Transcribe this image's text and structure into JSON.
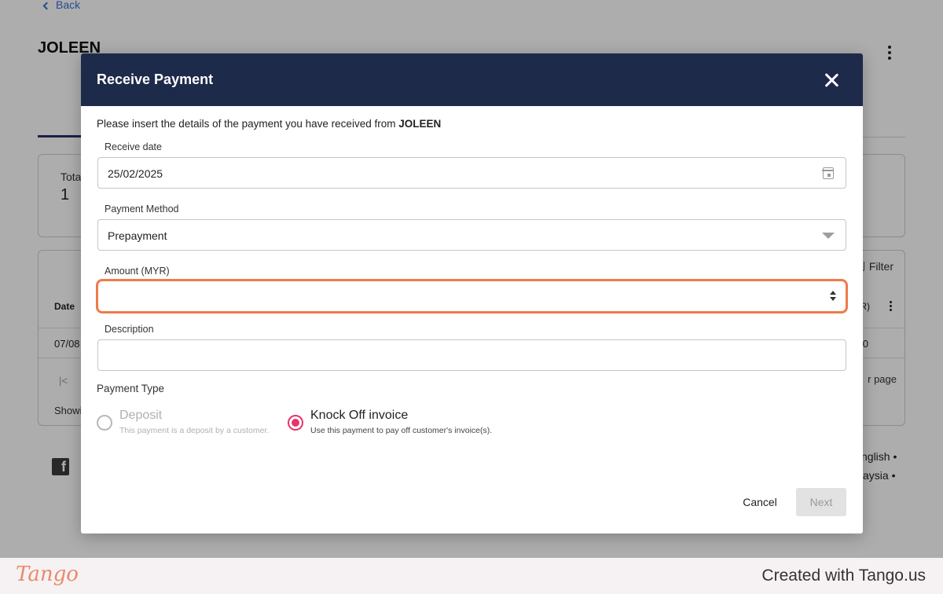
{
  "background": {
    "back_label": "Back",
    "customer_title": "JOLEEN",
    "stat_label": "Tota",
    "stat_value": "1",
    "filter_label": "Filter",
    "col_date": "Date",
    "col_right": "R)",
    "row_date": "07/08",
    "row_value": "0",
    "first_page_glyph": "|<",
    "per_page_label": "r page",
    "showing_label": "Showi",
    "lang_line1": "nglish •",
    "lang_line2": "aysia •"
  },
  "modal": {
    "title": "Receive Payment",
    "intro_text": "Please insert the details of the payment you have received from ",
    "intro_customer": "JOLEEN",
    "receive_date": {
      "label": "Receive date",
      "value": "25/02/2025"
    },
    "payment_method": {
      "label": "Payment Method",
      "value": "Prepayment"
    },
    "amount": {
      "label": "Amount (MYR)",
      "value": ""
    },
    "description": {
      "label": "Description",
      "value": ""
    },
    "payment_type": {
      "label": "Payment Type",
      "options": [
        {
          "title": "Deposit",
          "subtitle": "This payment is a deposit by a customer.",
          "selected": false,
          "disabled": true
        },
        {
          "title": "Knock Off invoice",
          "subtitle": "Use this payment to pay off customer's invoice(s).",
          "selected": true,
          "disabled": false
        }
      ]
    },
    "cancel_label": "Cancel",
    "next_label": "Next"
  },
  "footer": {
    "logo_text": "Tango",
    "created_text": "Created with Tango.us"
  },
  "colors": {
    "header_bg": "#1e2a4a",
    "highlight": "#f07a4a",
    "radio_selected": "#e6336b"
  }
}
